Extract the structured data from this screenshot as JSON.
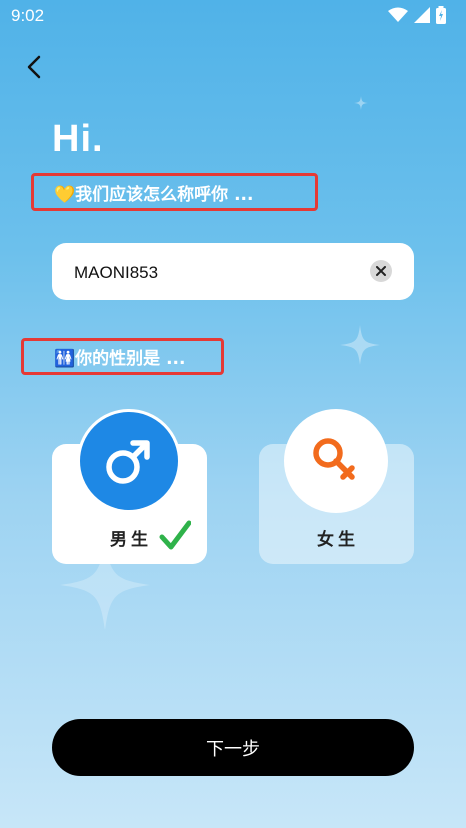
{
  "status_bar": {
    "time": "9:02"
  },
  "header": {
    "greeting": "Hi."
  },
  "name_section": {
    "prompt": "💛我们应该怎么称呼你 ...",
    "input_value": "MAONI853"
  },
  "gender_section": {
    "prompt": "🚻你的性别是 ...",
    "options": [
      {
        "label": "男生",
        "selected": true
      },
      {
        "label": "女生",
        "selected": false
      }
    ]
  },
  "footer": {
    "next_label": "下一步"
  },
  "colors": {
    "accent_blue": "#1e88e5",
    "female_orange": "#f26b1d",
    "check_green": "#2fb24a",
    "annotation_red": "#e53935"
  }
}
